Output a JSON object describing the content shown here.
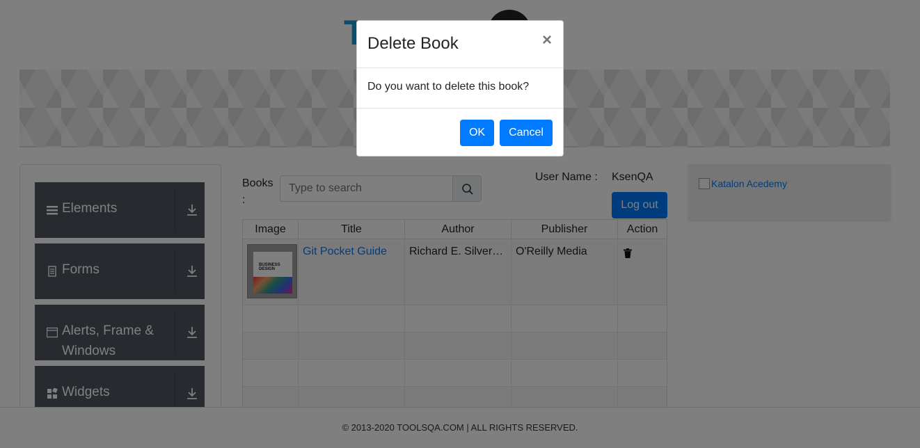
{
  "header": {
    "logo_text": "TOOLS"
  },
  "sidebar": {
    "groups": [
      {
        "label": "Elements",
        "icon": "hamburger-icon"
      },
      {
        "label": "Forms",
        "icon": "document-icon"
      },
      {
        "label": "Alerts, Frame & Windows",
        "icon": "window-icon"
      },
      {
        "label": "Widgets",
        "icon": "widgets-icon"
      }
    ]
  },
  "main": {
    "books_label": "Books :",
    "search_placeholder": "Type to search",
    "user_name_label": "User Name :",
    "user_name_value": "KsenQA",
    "logout_label": "Log out",
    "table": {
      "headers": [
        "Image",
        "Title",
        "Author",
        "Publisher",
        "Action"
      ],
      "rows": [
        {
          "title": "Git Pocket Guide",
          "author": "Richard E. Silverman",
          "publisher": "O'Reilly Media",
          "cover_text": "BUSINESS DESIGN"
        }
      ]
    }
  },
  "ad": {
    "alt_text": "Katalon Acedemy"
  },
  "footer": {
    "text": "© 2013-2020 TOOLSQA.COM | ALL RIGHTS RESERVED."
  },
  "modal": {
    "title": "Delete Book",
    "close": "×",
    "body": "Do you want to delete this book?",
    "ok_label": "OK",
    "cancel_label": "Cancel"
  },
  "colors": {
    "primary": "#007bff",
    "sidebar_bg": "#4f5761",
    "logo": "#1b9bd7"
  }
}
